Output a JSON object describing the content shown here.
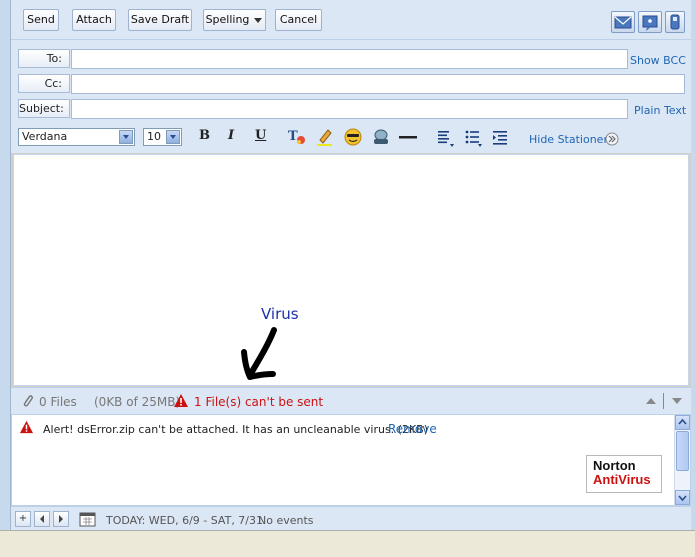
{
  "toolbar": {
    "send_label": "Send",
    "attach_label": "Attach",
    "save_draft_label": "Save Draft",
    "spelling_label": "Spelling",
    "cancel_label": "Cancel",
    "right_icons": [
      "envelope-icon",
      "notepad-icon",
      "mobile-phone-icon"
    ]
  },
  "header": {
    "to_label": "To:",
    "to_value": "",
    "cc_label": "Cc:",
    "cc_value": "",
    "subject_label": "Subject:",
    "subject_value": "",
    "show_bcc": "Show BCC",
    "plain_text": "Plain Text"
  },
  "format_bar": {
    "font": "Verdana",
    "size": "10",
    "bold": "B",
    "italic": "I",
    "underline": "U",
    "hide_stationery": "Hide Stationery",
    "icons": [
      "text-color-icon",
      "highlight-icon",
      "emoticon-icon",
      "insert-image-icon",
      "horizontal-rule-icon",
      "align-icon",
      "bullet-list-icon",
      "indent-icon",
      "expand-icon"
    ]
  },
  "body": {
    "annotation_text": "Virus"
  },
  "attachments": {
    "files_summary": "0 Files",
    "size_summary": "(0KB of 25MB)",
    "error_summary": "1 File(s) can't be sent"
  },
  "alert": {
    "message": "Alert! dsError.zip can't be attached. It has an uncleanable virus. (2KB)",
    "remove_label": "Remove",
    "norton_line1": "Norton",
    "norton_line2": "AntiVirus"
  },
  "status": {
    "calendar_text": "TODAY: WED, 6/9 - SAT, 7/31",
    "events_text": "No events"
  },
  "colors": {
    "chrome_blue": "#dbe7f5",
    "link_blue": "#1f66b4",
    "error_red": "#cc1111",
    "annotation_blue": "#1c2fae"
  }
}
